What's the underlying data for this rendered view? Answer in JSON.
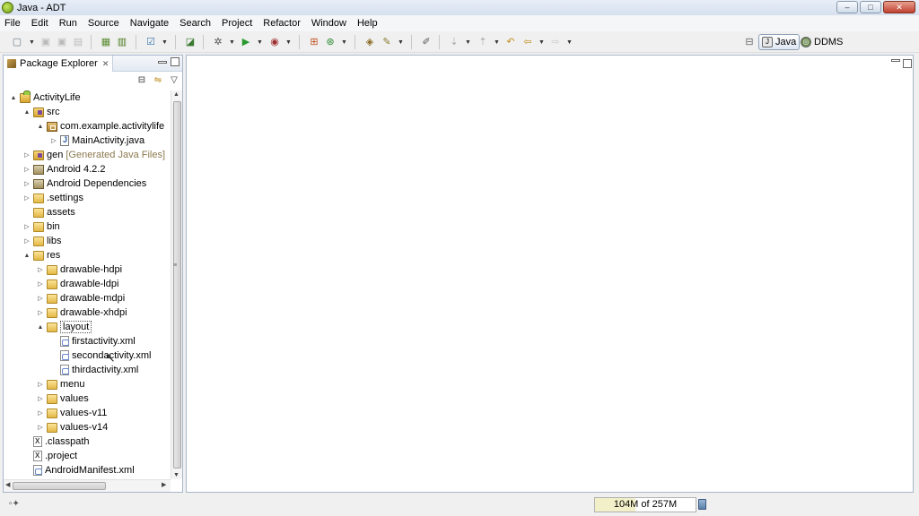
{
  "window": {
    "title": "Java - ADT",
    "controls": [
      "–",
      "□",
      "✕"
    ]
  },
  "menu": [
    "File",
    "Edit",
    "Run",
    "Source",
    "Navigate",
    "Search",
    "Project",
    "Refactor",
    "Window",
    "Help"
  ],
  "perspectives": [
    {
      "label": "Java",
      "active": true,
      "icon": "java-perspective-icon"
    },
    {
      "label": "DDMS",
      "active": false,
      "icon": "ddms-perspective-icon"
    }
  ],
  "package_explorer": {
    "title": "Package Explorer",
    "tree": [
      {
        "label": "ActivityLife",
        "decoration": "",
        "icon": "project",
        "twisty": "▲",
        "depth": 0
      },
      {
        "label": "src",
        "decoration": "",
        "icon": "srcfolder",
        "twisty": "▲",
        "depth": 1
      },
      {
        "label": "com.example.activitylife",
        "decoration": "",
        "icon": "package",
        "twisty": "▲",
        "depth": 2
      },
      {
        "label": "MainActivity.java",
        "decoration": "",
        "icon": "java",
        "twisty": "▷",
        "depth": 3
      },
      {
        "label": "gen",
        "decoration": "[Generated Java Files]",
        "icon": "srcfolder",
        "twisty": "▷",
        "depth": 1
      },
      {
        "label": "Android 4.2.2",
        "decoration": "",
        "icon": "lib",
        "twisty": "▷",
        "depth": 1
      },
      {
        "label": "Android Dependencies",
        "decoration": "",
        "icon": "lib",
        "twisty": "▷",
        "depth": 1
      },
      {
        "label": ".settings",
        "decoration": "",
        "icon": "folder",
        "twisty": "▷",
        "depth": 1
      },
      {
        "label": "assets",
        "decoration": "",
        "icon": "folder",
        "twisty": "",
        "depth": 1
      },
      {
        "label": "bin",
        "decoration": "",
        "icon": "folder",
        "twisty": "▷",
        "depth": 1
      },
      {
        "label": "libs",
        "decoration": "",
        "icon": "folder",
        "twisty": "▷",
        "depth": 1
      },
      {
        "label": "res",
        "decoration": "",
        "icon": "folder",
        "twisty": "▲",
        "depth": 1
      },
      {
        "label": "drawable-hdpi",
        "decoration": "",
        "icon": "folder",
        "twisty": "▷",
        "depth": 2
      },
      {
        "label": "drawable-ldpi",
        "decoration": "",
        "icon": "folder",
        "twisty": "▷",
        "depth": 2
      },
      {
        "label": "drawable-mdpi",
        "decoration": "",
        "icon": "folder",
        "twisty": "▷",
        "depth": 2
      },
      {
        "label": "drawable-xhdpi",
        "decoration": "",
        "icon": "folder",
        "twisty": "▷",
        "depth": 2
      },
      {
        "label": "layout",
        "decoration": "",
        "icon": "folder",
        "twisty": "▲",
        "depth": 2,
        "selected": true
      },
      {
        "label": "firstactivity.xml",
        "decoration": "",
        "icon": "xml",
        "twisty": "",
        "depth": 3
      },
      {
        "label": "secondactivity.xml",
        "decoration": "",
        "icon": "xml",
        "twisty": "",
        "depth": 3
      },
      {
        "label": "thirdactivity.xml",
        "decoration": "",
        "icon": "xml",
        "twisty": "",
        "depth": 3
      },
      {
        "label": "menu",
        "decoration": "",
        "icon": "folder",
        "twisty": "▷",
        "depth": 2
      },
      {
        "label": "values",
        "decoration": "",
        "icon": "folder",
        "twisty": "▷",
        "depth": 2
      },
      {
        "label": "values-v11",
        "decoration": "",
        "icon": "folder",
        "twisty": "▷",
        "depth": 2
      },
      {
        "label": "values-v14",
        "decoration": "",
        "icon": "folder",
        "twisty": "▷",
        "depth": 2
      },
      {
        "label": ".classpath",
        "decoration": "",
        "icon": "file",
        "twisty": "",
        "depth": 1
      },
      {
        "label": ".project",
        "decoration": "",
        "icon": "file",
        "twisty": "",
        "depth": 1
      },
      {
        "label": "AndroidManifest.xml",
        "decoration": "",
        "icon": "xml",
        "twisty": "",
        "depth": 1
      }
    ]
  },
  "status": {
    "heap_label": "104M of 257M",
    "heap_used_fraction": 0.405
  },
  "colors": {
    "selection_border": "#555555",
    "panel_border": "#a9b8cc",
    "heap_fill": "#f2f0c8"
  }
}
